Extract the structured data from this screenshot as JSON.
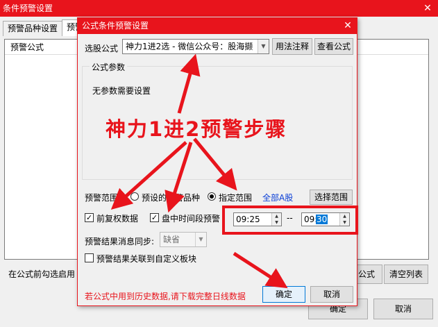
{
  "background_window": {
    "title": "条件预警设置",
    "close_glyph": "✕",
    "tabs": [
      "预警品种设置",
      "预警"
    ],
    "list_header": "预警公式",
    "hint": "在公式前勾选启用",
    "buttons": {
      "formula": "公式",
      "clear": "清空列表",
      "ok": "确定",
      "cancel": "取消"
    }
  },
  "dialog": {
    "title": "公式条件预警设置",
    "close_glyph": "✕",
    "formula_label": "选股公式",
    "formula_value": "神力1进2选  - 微信公众号：股海撷",
    "syntax_button": "用法注释",
    "view_button": "查看公式",
    "params_legend": "公式参数",
    "params_text": "无参数需要设置",
    "range_label": "预警范围",
    "range_options": [
      {
        "label": "预设的预警品种",
        "checked": false
      },
      {
        "label": "指定范围",
        "checked": true
      }
    ],
    "all_a_shares": "全部A股",
    "select_range_button": "选择范围",
    "adjusted_data": {
      "label": "前复权数据",
      "checked": true
    },
    "intraday_period": {
      "label": "盘中时间段预警",
      "checked": true
    },
    "time_start": "09:25",
    "time_separator": "--",
    "time_end_hour": "09:",
    "time_end_minute": "30",
    "sync_label": "预警结果消息同步:",
    "sync_value": "缺省",
    "link_block": {
      "label": "预警结果关联到自定义板块",
      "checked": false
    },
    "warning": "若公式中用到历史数据,请下载完整日线数据",
    "ok_button": "确定",
    "cancel_button": "取消"
  },
  "annotation": {
    "caption": "神力1进2预警步骤",
    "color": "#e8141c"
  },
  "colors": {
    "title_bar": "#e8141c",
    "link_blue": "#0b3fd6",
    "selection": "#0078d7"
  }
}
